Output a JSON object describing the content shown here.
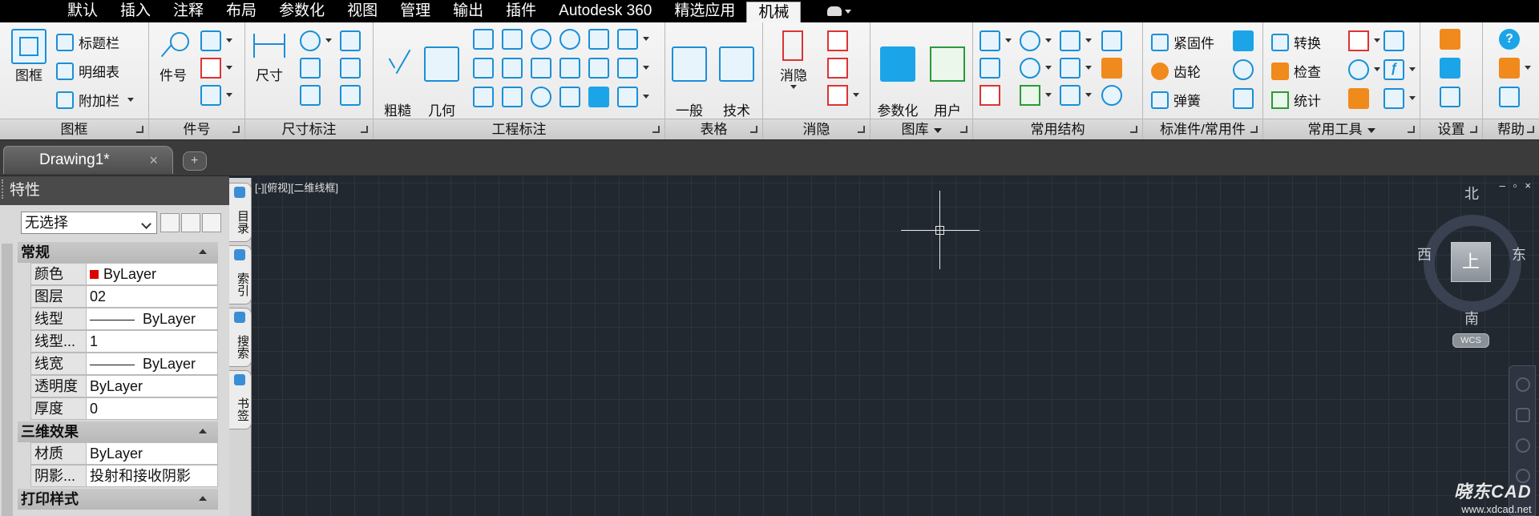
{
  "menu": {
    "tabs": [
      "默认",
      "插入",
      "注释",
      "布局",
      "参数化",
      "视图",
      "管理",
      "输出",
      "插件",
      "Autodesk 360",
      "精选应用",
      "机械"
    ],
    "active_tab": "机械"
  },
  "ribbon": {
    "panels": {
      "frame": {
        "title": "图框",
        "big": "图框",
        "items": [
          "标题栏",
          "明细表",
          "附加栏"
        ]
      },
      "partno": {
        "title": "件号",
        "big": "件号"
      },
      "dim": {
        "title": "尺寸标注",
        "big": "尺寸"
      },
      "annot": {
        "title": "工程标注",
        "big1": "粗糙\n度",
        "big2": "几何\n公差"
      },
      "table": {
        "title": "表格",
        "big1": "一般\n表格",
        "big2": "技术\n表格"
      },
      "hide": {
        "title": "消隐",
        "big": "消隐"
      },
      "lib": {
        "title": "图库",
        "big1": "参数化\n图库",
        "big2": "用户\n图库"
      },
      "struct": {
        "title": "常用结构"
      },
      "std": {
        "title": "标准件/常用件",
        "items": [
          "紧固件",
          "齿轮",
          "弹簧"
        ]
      },
      "tools": {
        "title": "常用工具",
        "items": [
          "转换",
          "检查",
          "统计"
        ]
      },
      "settings": {
        "title": "设置"
      },
      "help": {
        "title": "帮助"
      }
    }
  },
  "doc": {
    "tab_title": "Drawing1*",
    "close": "×"
  },
  "properties": {
    "title": "特性",
    "selection": "无选择",
    "sections": [
      {
        "name": "常规",
        "rows": [
          {
            "k": "颜色",
            "v": "ByLayer"
          },
          {
            "k": "图层",
            "v": "02"
          },
          {
            "k": "线型",
            "v": "ByLayer"
          },
          {
            "k": "线型...",
            "v": "1"
          },
          {
            "k": "线宽",
            "v": "ByLayer"
          },
          {
            "k": "透明度",
            "v": "ByLayer"
          },
          {
            "k": "厚度",
            "v": "0"
          }
        ]
      },
      {
        "name": "三维效果",
        "rows": [
          {
            "k": "材质",
            "v": "ByLayer"
          },
          {
            "k": "阴影...",
            "v": "投射和接收阴影"
          }
        ]
      },
      {
        "name": "打印样式",
        "rows": []
      }
    ]
  },
  "side_tabs": [
    "目录",
    "索引",
    "搜索",
    "书签"
  ],
  "viewport": {
    "label": "[-][俯视][二维线框]",
    "controls": [
      "‒",
      "▫",
      "×"
    ]
  },
  "viewcube": {
    "top": "上",
    "north": "北",
    "south": "南",
    "east": "东",
    "west": "西",
    "wcs": "WCS"
  },
  "watermark": {
    "brand": "晓东CAD",
    "url": "www.xdcad.net"
  },
  "colors": {
    "accent": "#1a8fd6",
    "canvas": "#212830",
    "bylayer_red": "#dd0000"
  }
}
